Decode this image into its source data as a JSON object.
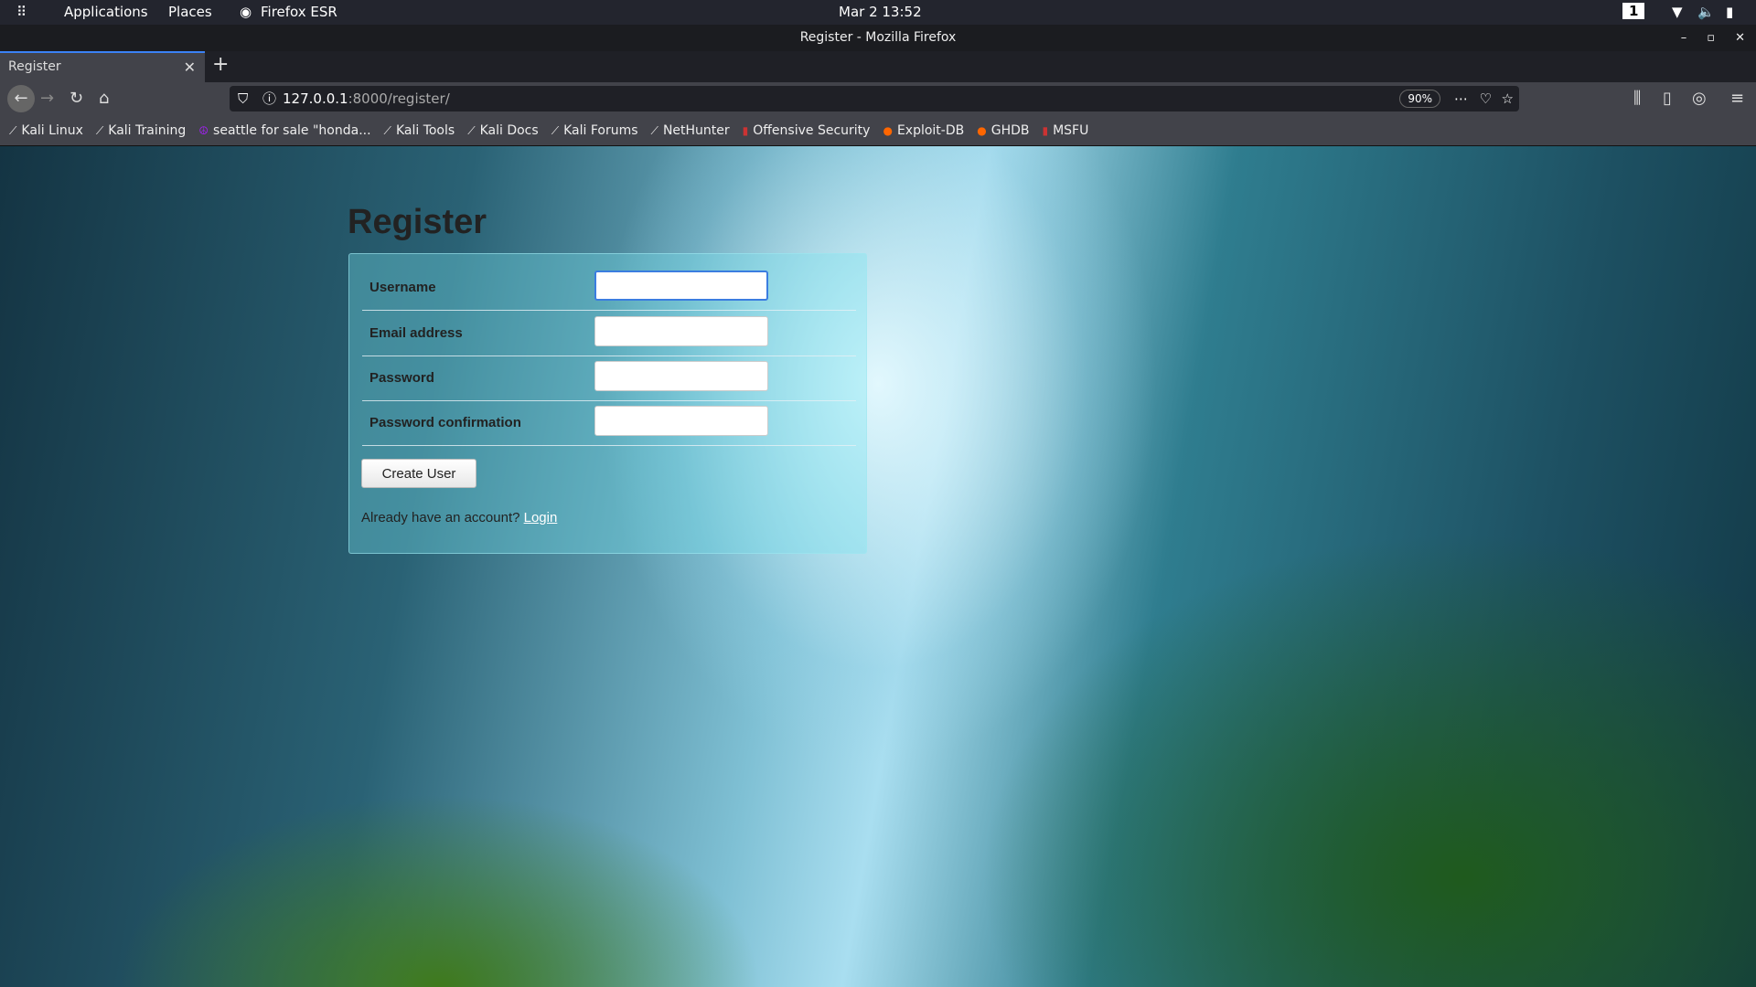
{
  "topbar": {
    "applications": "Applications",
    "places": "Places",
    "app": "Firefox ESR",
    "datetime": "Mar 2  13:52",
    "workspace": "1"
  },
  "window": {
    "title": "Register - Mozilla Firefox"
  },
  "tabs": [
    {
      "label": "Register"
    }
  ],
  "url": {
    "host": "127.0.0.1",
    "rest": ":8000/register/",
    "zoom": "90%"
  },
  "bookmarks": [
    "Kali Linux",
    "Kali Training",
    "seattle for sale \"honda...",
    "Kali Tools",
    "Kali Docs",
    "Kali Forums",
    "NetHunter",
    "Offensive Security",
    "Exploit-DB",
    "GHDB",
    "MSFU"
  ],
  "page": {
    "heading": "Register",
    "fields": [
      {
        "label": "Username",
        "value": ""
      },
      {
        "label": "Email address",
        "value": ""
      },
      {
        "label": "Password",
        "value": ""
      },
      {
        "label": "Password confirmation",
        "value": ""
      }
    ],
    "submit": "Create User",
    "already": "Already have an account?",
    "login": "Login"
  }
}
